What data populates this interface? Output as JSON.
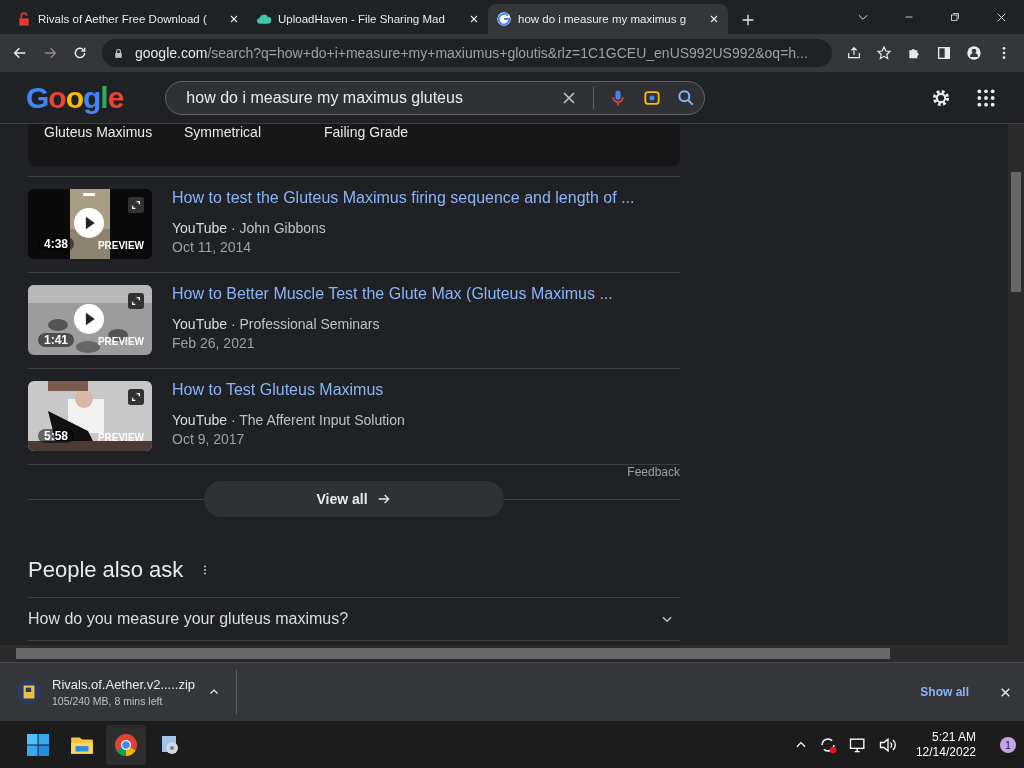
{
  "tabs": [
    {
      "title": "Rivals of Aether Free Download (",
      "selected": false
    },
    {
      "title": "UploadHaven - File Sharing Mad",
      "selected": false
    },
    {
      "title": "how do i measure my maximus g",
      "selected": true
    }
  ],
  "address": {
    "host": "google.com",
    "path": "/search?q=how+do+i+measure+my+maxiumus+gloutis&rlz=1C1GCEU_enUS992US992&oq=h..."
  },
  "header": {
    "logo": "Google",
    "query": "how do i measure my maximus gluteus"
  },
  "carousel": [
    "Gluteus Maximus",
    "Symmetrical",
    "Failing Grade"
  ],
  "videos": [
    {
      "title": "How to test the Gluteus Maximus firing sequence and length of ...",
      "source": "YouTube",
      "separator": "·",
      "channel": "John Gibbons",
      "date": "Oct 11, 2014",
      "duration": "4:38",
      "badge": "PREVIEW",
      "play": true
    },
    {
      "title": "How to Better Muscle Test the Glute Max (Gluteus Maximus ...",
      "source": "YouTube",
      "separator": "·",
      "channel": "Professional Seminars",
      "date": "Feb 26, 2021",
      "duration": "1:41",
      "badge": "PREVIEW",
      "play": true
    },
    {
      "title": "How to Test Gluteus Maximus",
      "source": "YouTube",
      "separator": "·",
      "channel": "The Afferent Input Solution",
      "date": "Oct 9, 2017",
      "duration": "5:58",
      "badge": "PREVIEW",
      "play": false
    }
  ],
  "feedback": "Feedback",
  "view_all": "View all",
  "people_also_ask": {
    "title": "People also ask",
    "questions": [
      {
        "text": "How do you measure your gluteus maximus?",
        "expanded": false
      }
    ]
  },
  "download": {
    "file": "Rivals.of.Aether.v2.....zip",
    "progress": "105/240 MB, 8 mins left",
    "show_all": "Show all"
  },
  "taskbar": {
    "time": "5:21 AM",
    "date": "12/14/2022",
    "notifications": "1"
  }
}
